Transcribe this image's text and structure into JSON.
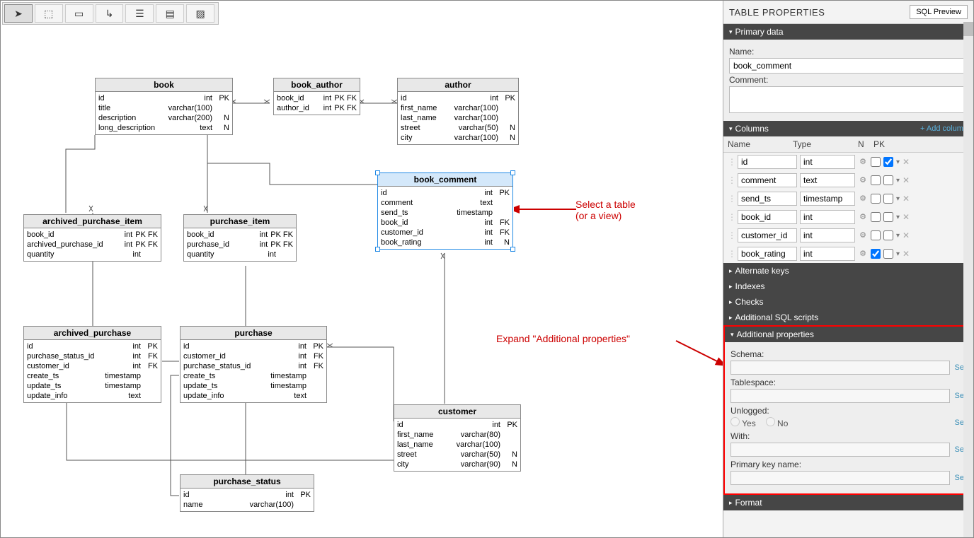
{
  "toolbar": {
    "tools": [
      "pointer",
      "marquee",
      "table",
      "connector",
      "list",
      "note",
      "hatch"
    ]
  },
  "tables": {
    "book": {
      "title": "book",
      "rows": [
        {
          "name": "id",
          "type": "int",
          "flags": "PK"
        },
        {
          "name": "title",
          "type": "varchar(100)",
          "flags": ""
        },
        {
          "name": "description",
          "type": "varchar(200)",
          "flags": "N"
        },
        {
          "name": "long_description",
          "type": "text",
          "flags": "N"
        }
      ]
    },
    "book_author": {
      "title": "book_author",
      "rows": [
        {
          "name": "book_id",
          "type": "int",
          "flags": "PK FK"
        },
        {
          "name": "author_id",
          "type": "int",
          "flags": "PK FK"
        }
      ]
    },
    "author": {
      "title": "author",
      "rows": [
        {
          "name": "id",
          "type": "int",
          "flags": "PK"
        },
        {
          "name": "first_name",
          "type": "varchar(100)",
          "flags": ""
        },
        {
          "name": "last_name",
          "type": "varchar(100)",
          "flags": ""
        },
        {
          "name": "street",
          "type": "varchar(50)",
          "flags": "N"
        },
        {
          "name": "city",
          "type": "varchar(100)",
          "flags": "N"
        }
      ]
    },
    "book_comment": {
      "title": "book_comment",
      "rows": [
        {
          "name": "id",
          "type": "int",
          "flags": "PK"
        },
        {
          "name": "comment",
          "type": "text",
          "flags": ""
        },
        {
          "name": "send_ts",
          "type": "timestamp",
          "flags": ""
        },
        {
          "name": "book_id",
          "type": "int",
          "flags": "FK"
        },
        {
          "name": "customer_id",
          "type": "int",
          "flags": "FK"
        },
        {
          "name": "book_rating",
          "type": "int",
          "flags": "N"
        }
      ]
    },
    "archived_purchase_item": {
      "title": "archived_purchase_item",
      "rows": [
        {
          "name": "book_id",
          "type": "int",
          "flags": "PK FK"
        },
        {
          "name": "archived_purchase_id",
          "type": "int",
          "flags": "PK FK"
        },
        {
          "name": "quantity",
          "type": "int",
          "flags": ""
        }
      ]
    },
    "purchase_item": {
      "title": "purchase_item",
      "rows": [
        {
          "name": "book_id",
          "type": "int",
          "flags": "PK FK"
        },
        {
          "name": "purchase_id",
          "type": "int",
          "flags": "PK FK"
        },
        {
          "name": "quantity",
          "type": "int",
          "flags": ""
        }
      ]
    },
    "archived_purchase": {
      "title": "archived_purchase",
      "rows": [
        {
          "name": "id",
          "type": "int",
          "flags": "PK"
        },
        {
          "name": "purchase_status_id",
          "type": "int",
          "flags": "FK"
        },
        {
          "name": "customer_id",
          "type": "int",
          "flags": "FK"
        },
        {
          "name": "create_ts",
          "type": "timestamp",
          "flags": ""
        },
        {
          "name": "update_ts",
          "type": "timestamp",
          "flags": ""
        },
        {
          "name": "update_info",
          "type": "text",
          "flags": ""
        }
      ]
    },
    "purchase": {
      "title": "purchase",
      "rows": [
        {
          "name": "id",
          "type": "int",
          "flags": "PK"
        },
        {
          "name": "customer_id",
          "type": "int",
          "flags": "FK"
        },
        {
          "name": "purchase_status_id",
          "type": "int",
          "flags": "FK"
        },
        {
          "name": "create_ts",
          "type": "timestamp",
          "flags": ""
        },
        {
          "name": "update_ts",
          "type": "timestamp",
          "flags": ""
        },
        {
          "name": "update_info",
          "type": "text",
          "flags": ""
        }
      ]
    },
    "customer": {
      "title": "customer",
      "rows": [
        {
          "name": "id",
          "type": "int",
          "flags": "PK"
        },
        {
          "name": "first_name",
          "type": "varchar(80)",
          "flags": ""
        },
        {
          "name": "last_name",
          "type": "varchar(100)",
          "flags": ""
        },
        {
          "name": "street",
          "type": "varchar(50)",
          "flags": "N"
        },
        {
          "name": "city",
          "type": "varchar(90)",
          "flags": "N"
        }
      ]
    },
    "purchase_status": {
      "title": "purchase_status",
      "rows": [
        {
          "name": "id",
          "type": "int",
          "flags": "PK"
        },
        {
          "name": "name",
          "type": "varchar(100)",
          "flags": ""
        }
      ]
    }
  },
  "annotations": {
    "selectTable": "Select a table\n(or a view)",
    "expandAP": "Expand \"Additional properties\""
  },
  "sidepanel": {
    "title": "TABLE PROPERTIES",
    "sqlPreview": "SQL Preview",
    "sections": {
      "primary": {
        "label": "Primary data",
        "name_label": "Name:",
        "name_value": "book_comment",
        "comment_label": "Comment:",
        "comment_value": ""
      },
      "columns": {
        "label": "Columns",
        "addcol": "+ Add column",
        "headers": {
          "name": "Name",
          "type": "Type",
          "n": "N",
          "pk": "PK"
        },
        "rows": [
          {
            "name": "id",
            "type": "int",
            "n": false,
            "pk": true
          },
          {
            "name": "comment",
            "type": "text",
            "n": false,
            "pk": false
          },
          {
            "name": "send_ts",
            "type": "timestamp",
            "n": false,
            "pk": false
          },
          {
            "name": "book_id",
            "type": "int",
            "n": false,
            "pk": false
          },
          {
            "name": "customer_id",
            "type": "int",
            "n": false,
            "pk": false
          },
          {
            "name": "book_rating",
            "type": "int",
            "n": true,
            "pk": false
          }
        ]
      },
      "alternateKeys": "Alternate keys",
      "indexes": "Indexes",
      "checks": "Checks",
      "addSql": "Additional SQL scripts",
      "addProps": {
        "label": "Additional properties",
        "schema_label": "Schema:",
        "tablespace_label": "Tablespace:",
        "unlogged_label": "Unlogged:",
        "yes": "Yes",
        "no": "No",
        "with_label": "With:",
        "pkname_label": "Primary key name:",
        "set": "Set"
      },
      "format": "Format"
    }
  }
}
